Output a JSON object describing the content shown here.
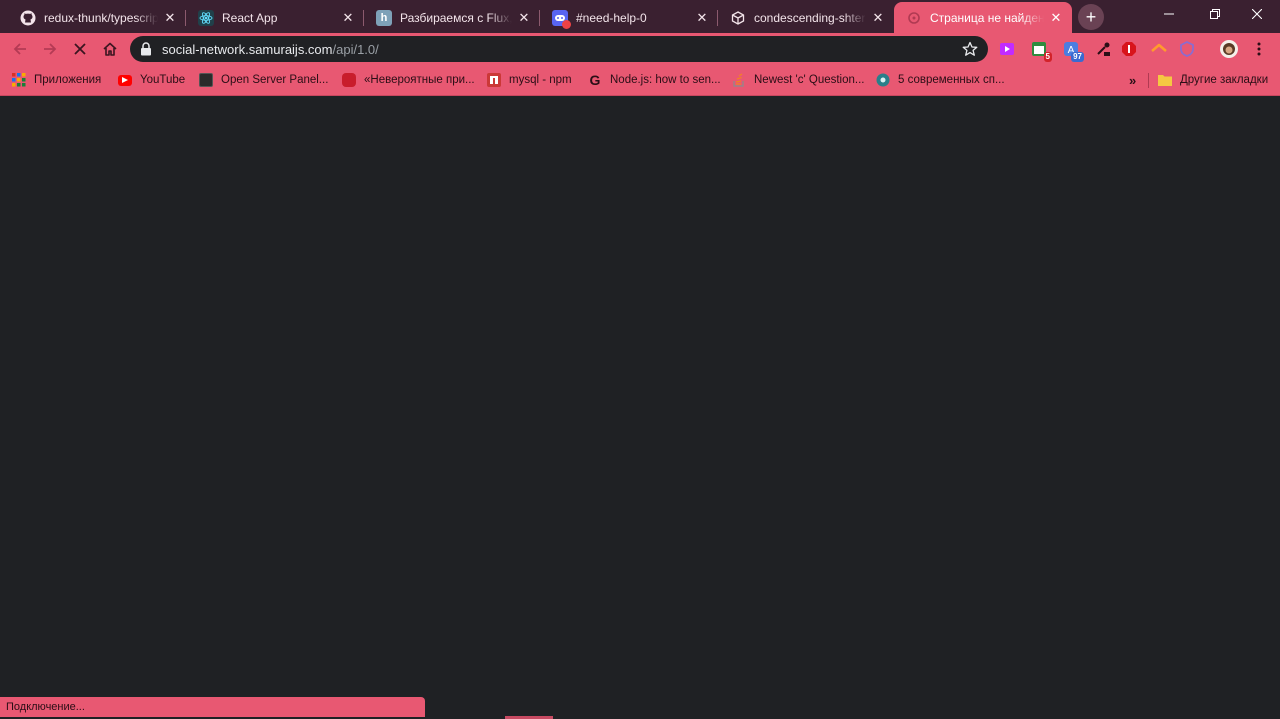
{
  "tabs": [
    {
      "title": "redux-thunk/typescript",
      "icon": "github-icon"
    },
    {
      "title": "React App",
      "icon": "react-icon"
    },
    {
      "title": "Разбираемся с Flux, ре",
      "icon": "habr-icon"
    },
    {
      "title": "#need-help-0",
      "icon": "discord-icon"
    },
    {
      "title": "condescending-shtern",
      "icon": "codesandbox-icon"
    },
    {
      "title": "Страница не найдена",
      "icon": "page-icon",
      "active": true
    }
  ],
  "address_bar": {
    "host": "social-network.samuraijs.com",
    "path": "/api/1.0/"
  },
  "extension_badges": {
    "ext2": "5",
    "ext3": "97"
  },
  "bookmarks": [
    {
      "label": "Приложения",
      "icon": "apps-icon"
    },
    {
      "label": "YouTube",
      "icon": "youtube-icon"
    },
    {
      "label": "Open Server Panel...",
      "icon": "server-icon"
    },
    {
      "label": "«Невероятные при...",
      "icon": "bookmark-red-icon"
    },
    {
      "label": "mysql - npm",
      "icon": "npm-icon"
    },
    {
      "label": "Node.js: how to sen...",
      "icon": "google-icon"
    },
    {
      "label": "Newest 'c' Question...",
      "icon": "stackoverflow-icon"
    },
    {
      "label": "5 современных сп...",
      "icon": "globe-icon"
    }
  ],
  "other_bookmarks": "Другие закладки",
  "status": "Подключение...",
  "colors": {
    "frame": "#3a2030",
    "accent": "#e85872",
    "content": "#1f2124"
  }
}
